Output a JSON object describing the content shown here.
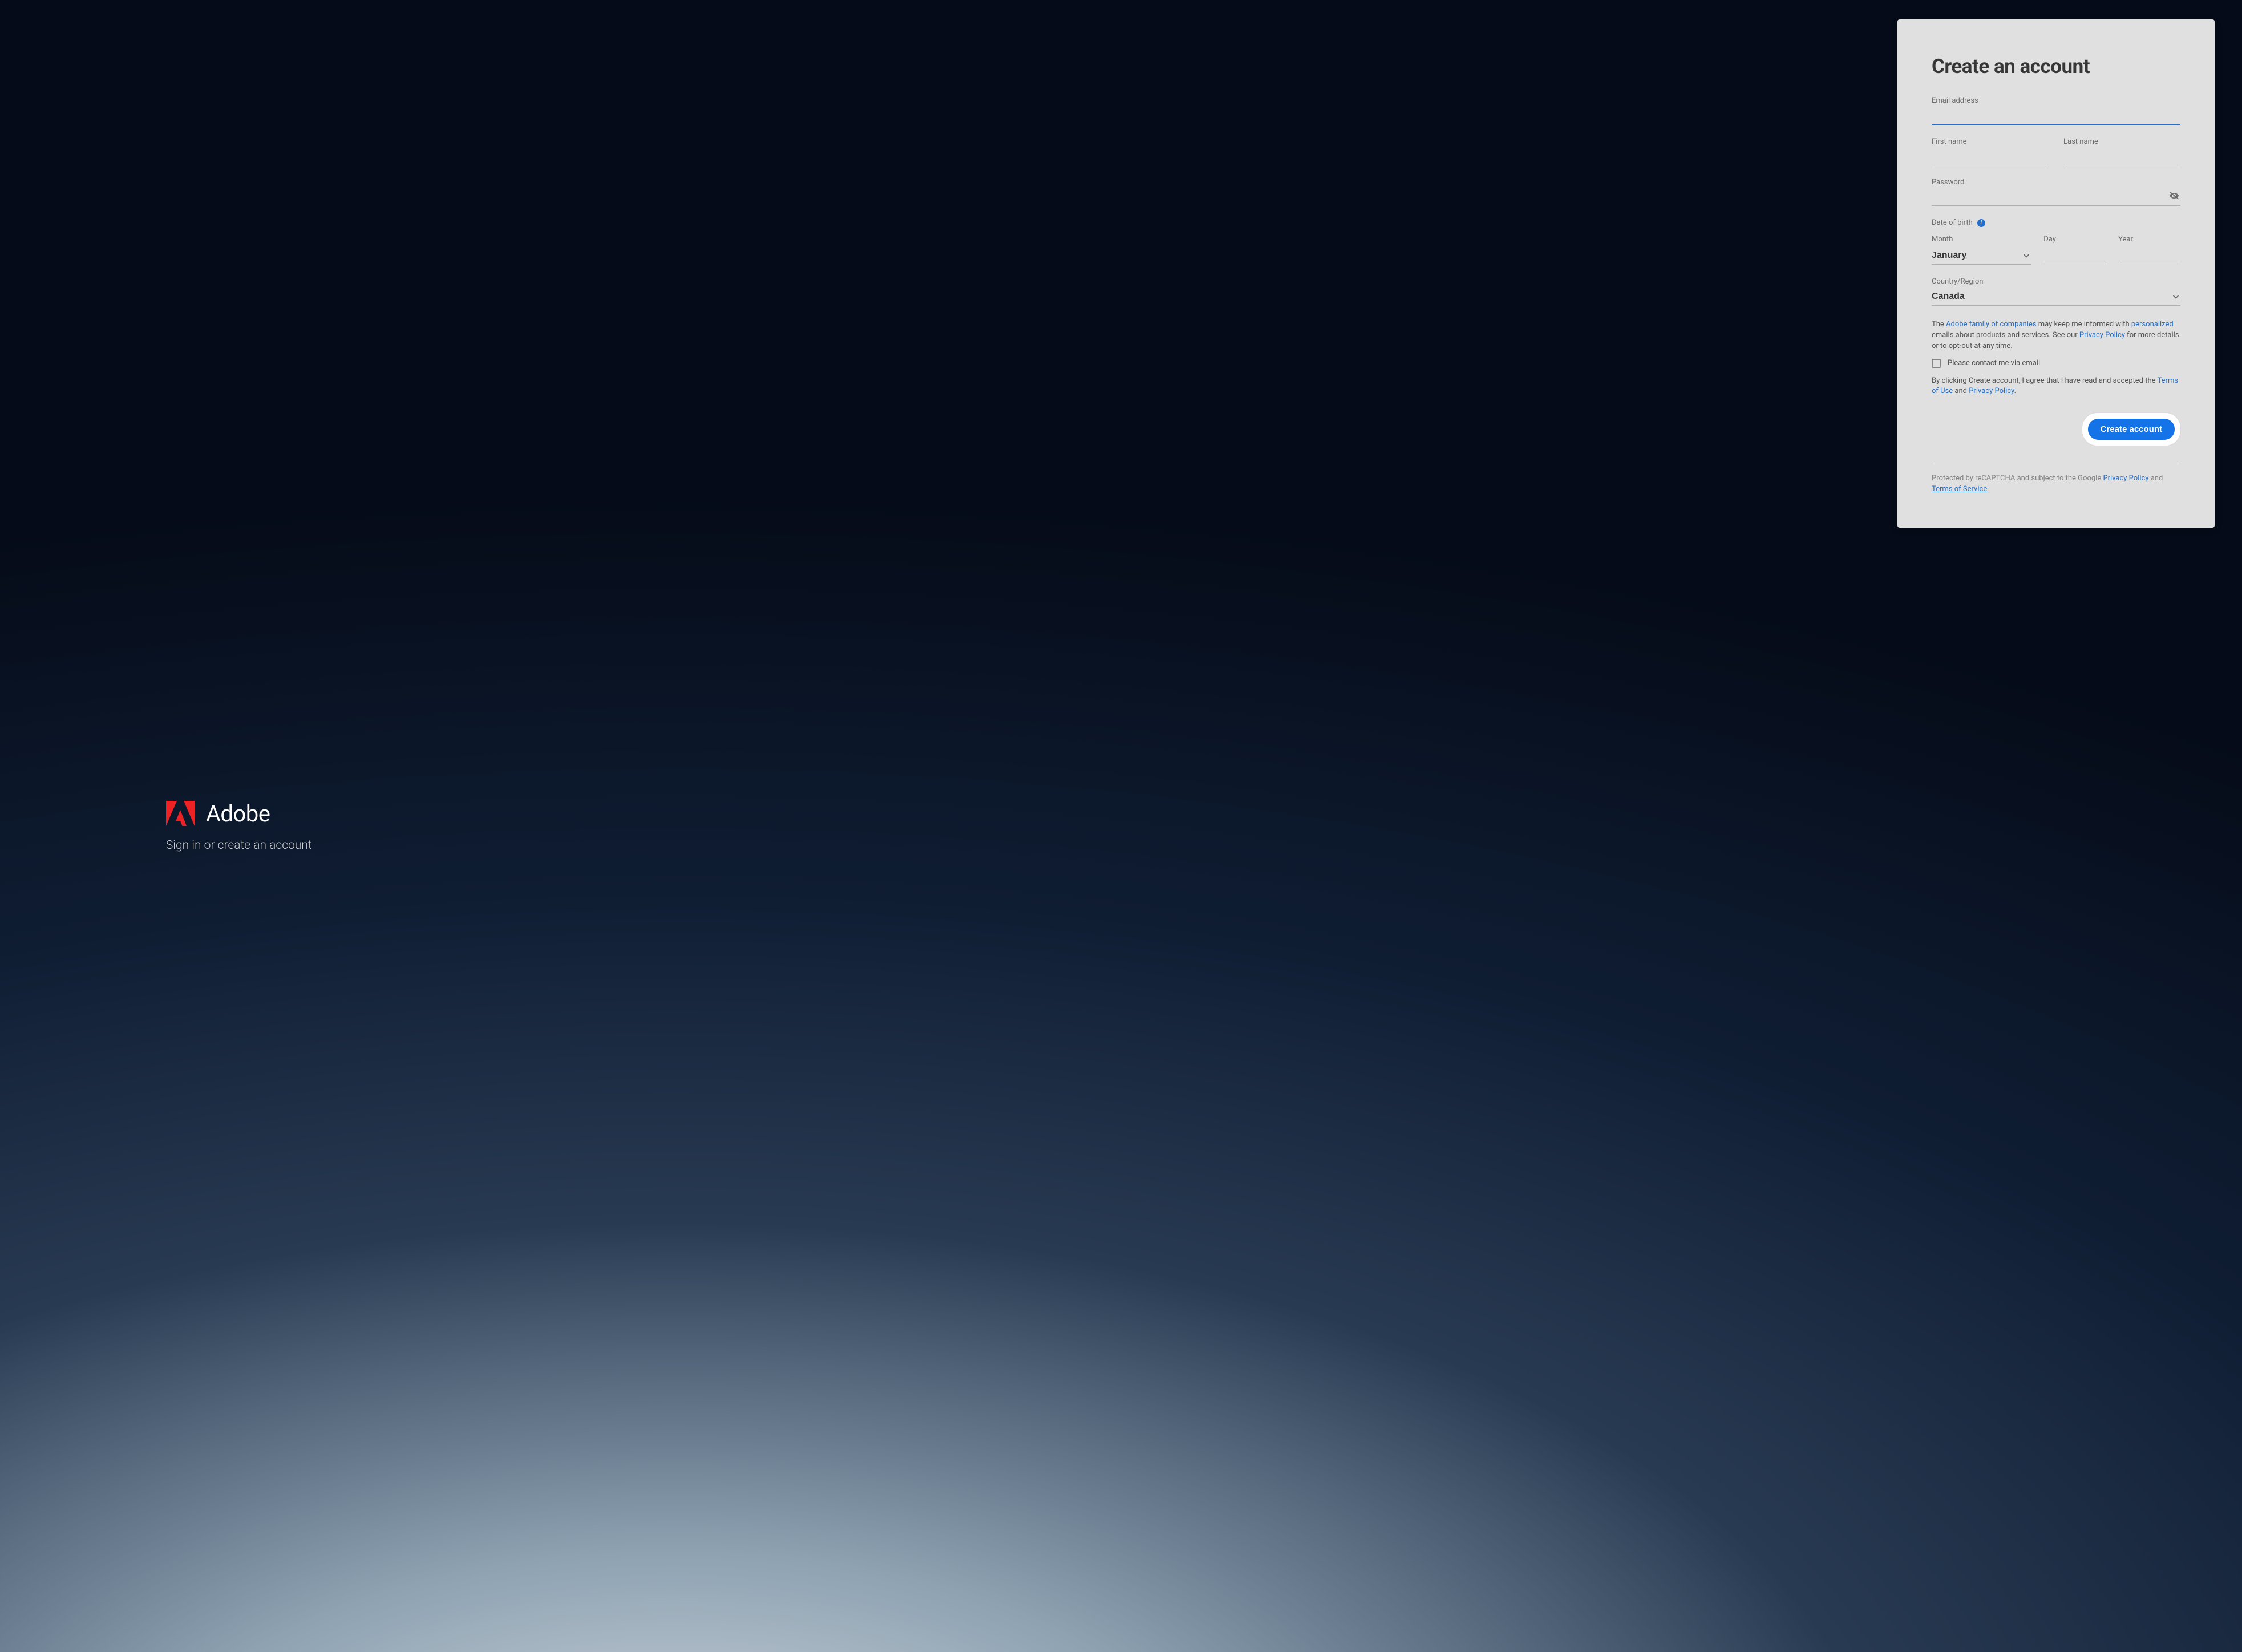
{
  "brand": {
    "name": "Adobe",
    "subtitle": "Sign in or create an account"
  },
  "form": {
    "title": "Create an account",
    "email_label": "Email address",
    "email_value": "",
    "first_name_label": "First name",
    "first_name_value": "",
    "last_name_label": "Last name",
    "last_name_value": "",
    "password_label": "Password",
    "password_value": "",
    "dob_label": "Date of birth",
    "month_label": "Month",
    "month_value": "January",
    "day_label": "Day",
    "day_value": "",
    "year_label": "Year",
    "year_value": "",
    "country_label": "Country/Region",
    "country_value": "Canada",
    "marketing_text_prefix": "The ",
    "marketing_link1": "Adobe family of companies",
    "marketing_text_mid1": " may keep me informed with ",
    "marketing_link2": "personalized",
    "marketing_text_mid2": " emails about products and services. See our ",
    "marketing_link3": "Privacy Policy",
    "marketing_text_suffix": " for more details or to opt-out at any time.",
    "contact_label": "Please contact me via email",
    "agree_prefix": "By clicking Create account, I agree that I have read and accepted the ",
    "agree_link1": "Terms of Use",
    "agree_mid": " and ",
    "agree_link2": "Privacy Policy",
    "agree_suffix": ".",
    "submit_label": "Create account",
    "recaptcha_prefix": "Protected by reCAPTCHA and subject to the Google ",
    "recaptcha_link1": "Privacy Policy",
    "recaptcha_mid": " and ",
    "recaptcha_link2": "Terms of Service",
    "recaptcha_suffix": "."
  }
}
